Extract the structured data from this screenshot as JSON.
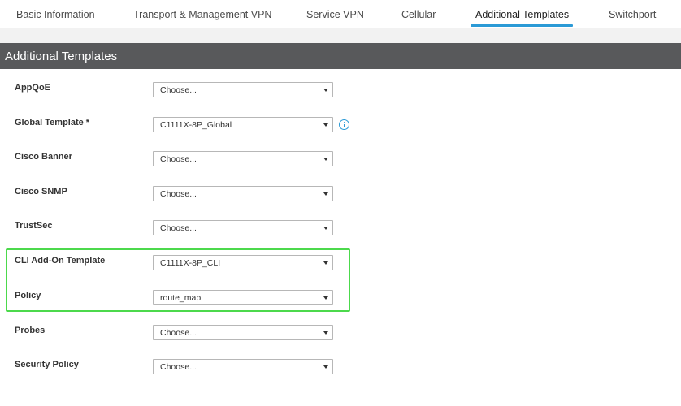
{
  "tabs": [
    {
      "label": "Basic Information"
    },
    {
      "label": "Transport & Management VPN"
    },
    {
      "label": "Service VPN"
    },
    {
      "label": "Cellular"
    },
    {
      "label": "Additional Templates"
    },
    {
      "label": "Switchport"
    }
  ],
  "active_tab": "Additional Templates",
  "section": {
    "title": "Additional Templates"
  },
  "fields": [
    {
      "label": "AppQoE",
      "value": "Choose..."
    },
    {
      "label": "Global Template *",
      "value": "C1111X-8P_Global"
    },
    {
      "label": "Cisco Banner",
      "value": "Choose..."
    },
    {
      "label": "Cisco SNMP",
      "value": "Choose..."
    },
    {
      "label": "TrustSec",
      "value": "Choose..."
    },
    {
      "label": "CLI Add-On Template",
      "value": "C1111X-8P_CLI"
    },
    {
      "label": "Policy",
      "value": "route_map"
    },
    {
      "label": "Probes",
      "value": "Choose..."
    },
    {
      "label": "Security Policy",
      "value": "Choose..."
    }
  ],
  "icons": {
    "info": "info-icon",
    "dropdown": "chevron-down-icon"
  },
  "colors": {
    "accent": "#2b9ad6",
    "header_bg": "#58595b",
    "highlight": "#4cd94c"
  }
}
